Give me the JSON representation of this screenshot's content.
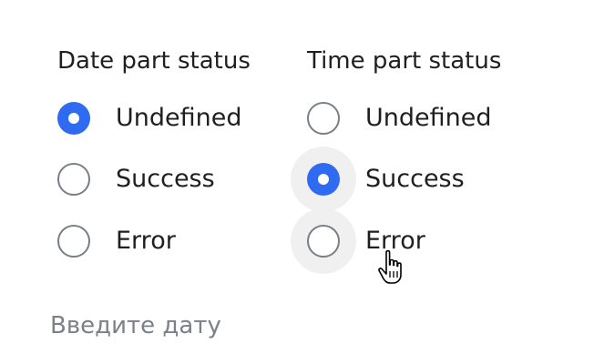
{
  "accent_color": "#2f6bf0",
  "date_group": {
    "title": "Date part status",
    "options": [
      {
        "label": "Undefined",
        "checked": true
      },
      {
        "label": "Success",
        "checked": false
      },
      {
        "label": "Error",
        "checked": false
      }
    ]
  },
  "time_group": {
    "title": "Time part status",
    "options": [
      {
        "label": "Undefined",
        "checked": false
      },
      {
        "label": "Success",
        "checked": true
      },
      {
        "label": "Error",
        "checked": false
      }
    ]
  },
  "date_input": {
    "placeholder": "Введите дату"
  },
  "cursor_icon": "hand-pointer-icon"
}
